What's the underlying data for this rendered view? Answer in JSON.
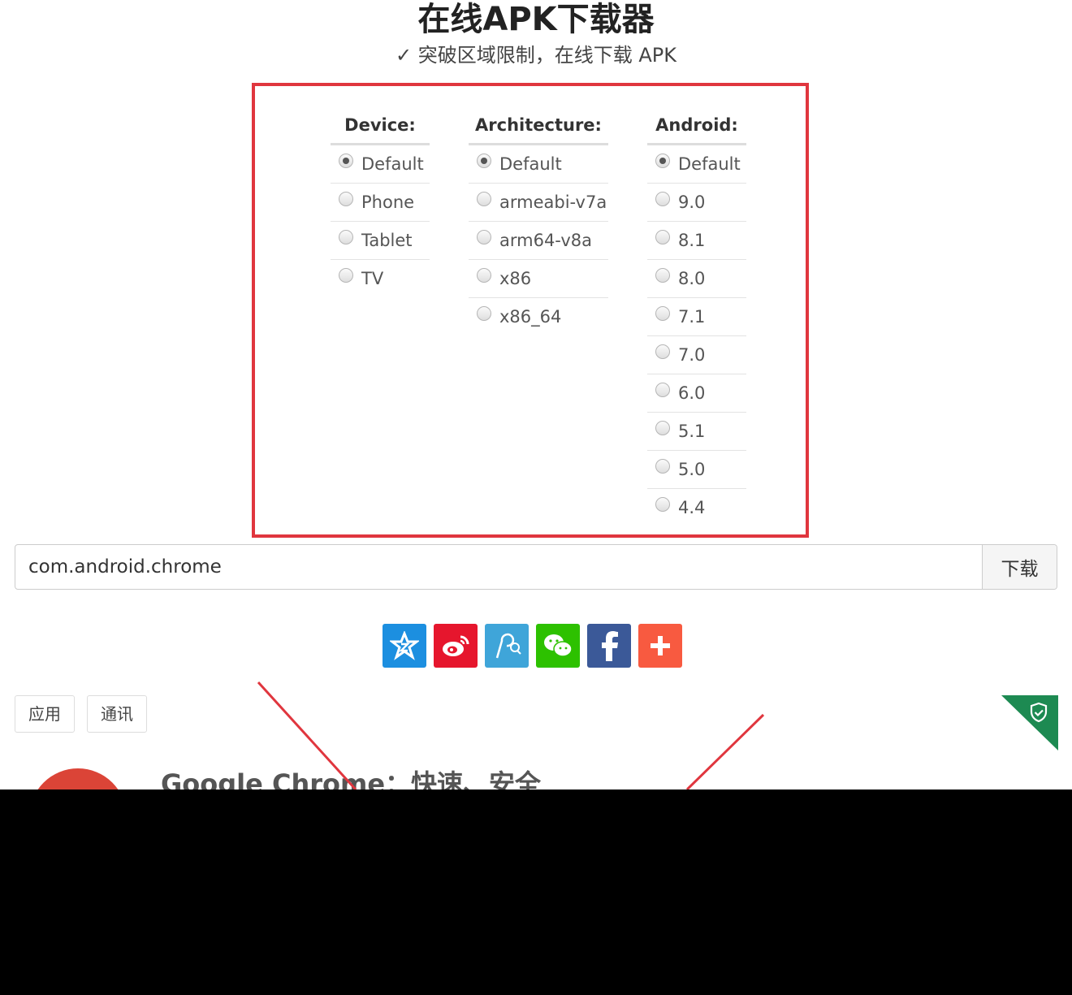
{
  "header": {
    "title": "在线APK下载器",
    "subtitle": "✓ 突破区域限制，在线下载 APK"
  },
  "options": {
    "device": {
      "heading": "Device:",
      "items": [
        "Default",
        "Phone",
        "Tablet",
        "TV"
      ],
      "selected": "Default"
    },
    "architecture": {
      "heading": "Architecture:",
      "items": [
        "Default",
        "armeabi-v7a",
        "arm64-v8a",
        "x86",
        "x86_64"
      ],
      "selected": "Default"
    },
    "android": {
      "heading": "Android:",
      "items": [
        "Default",
        "9.0",
        "8.1",
        "8.0",
        "7.1",
        "7.0",
        "6.0",
        "5.1",
        "5.0",
        "4.4"
      ],
      "selected": "Default"
    }
  },
  "search": {
    "value": "com.android.chrome",
    "button_label": "下载"
  },
  "share": {
    "icons": [
      "qzone-icon",
      "weibo-icon",
      "tencent-weibo-icon",
      "wechat-icon",
      "facebook-icon",
      "more-icon"
    ],
    "colors": [
      "#1c8fe0",
      "#e6162d",
      "#3fa5d9",
      "#2dc100",
      "#3b5998",
      "#f85a40"
    ]
  },
  "tabs": {
    "apps": "应用",
    "communication": "通讯"
  },
  "app": {
    "title": "Google Chrome：快速、安全"
  },
  "colors": {
    "highlight_border": "#e0363e",
    "shield_corner": "#1d8a52"
  }
}
